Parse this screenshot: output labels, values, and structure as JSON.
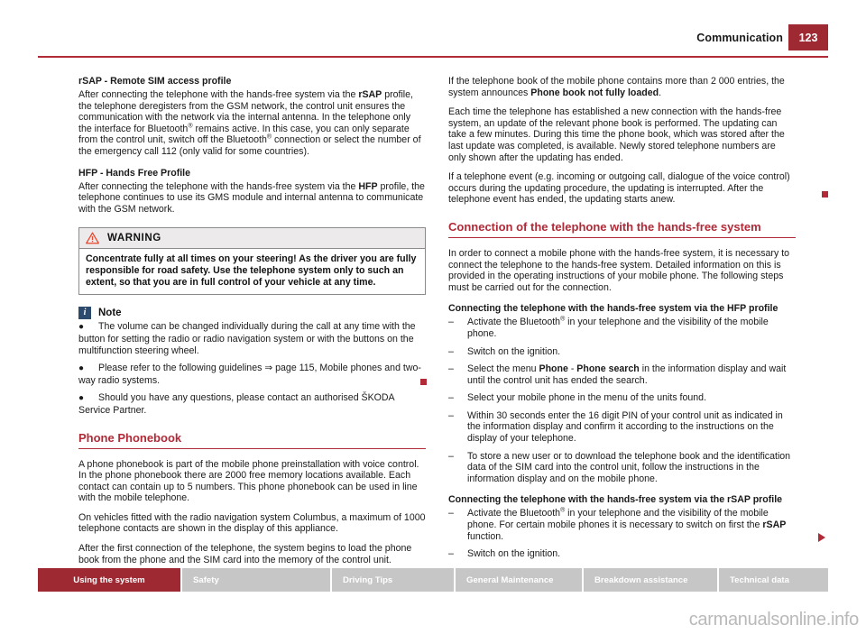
{
  "header": {
    "title": "Communication",
    "page_number": "123"
  },
  "left_column": {
    "rsap_heading": "rSAP - Remote SIM access profile",
    "rsap_paragraph": {
      "part1": "After connecting the telephone with the hands-free system via the ",
      "bold1": "rSAP",
      "part2": " profile, the telephone deregisters from the GSM network, the control unit ensures the communication with the network via the internal antenna. In the telephone only the interface for Bluetooth",
      "sup1": "®",
      "part3": " remains active. In this case, you can only separate from the control unit, switch off the Bluetooth",
      "sup2": "®",
      "part4": " connection or select the number of the emergency call 112 (only valid for some countries)."
    },
    "hfp_heading": "HFP - Hands Free Profile",
    "hfp_paragraph": {
      "part1": "After connecting the telephone with the hands-free system via the ",
      "bold1": "HFP",
      "part2": " profile, the telephone continues to use its GMS module and internal antenna to communicate with the GSM network."
    },
    "warning": {
      "label": "WARNING",
      "icon": "warning-triangle-icon",
      "body": "Concentrate fully at all times on your steering! As the driver you are fully responsible for road safety. Use the telephone system only to such an extent, so that you are in full control of your vehicle at any time."
    },
    "note": {
      "label": "Note",
      "icon": "info-icon",
      "bullets": [
        "The volume can be changed individually during the call at any time with the button for setting the radio or radio navigation system or with the buttons on the multifunction steering wheel.",
        "Please refer to the following guidelines ⇒ page 115, Mobile phones and two-way radio systems.",
        "Should you have any questions, please contact an authorised ŠKODA Service Partner."
      ]
    },
    "phonebook_heading": "Phone Phonebook",
    "phonebook_paragraphs": [
      "A phone phonebook is part of the mobile phone preinstallation with voice control. In the phone phonebook there are 2000 free memory locations available. Each contact can contain up to 5 numbers. This phone phonebook can be used in line with the mobile telephone.",
      "On vehicles fitted with the radio navigation system Columbus, a maximum of 1000 telephone contacts are shown in the display of this appliance.",
      "After the first connection of the telephone, the system begins to load the phone book from the phone and the SIM card into the memory of the control unit."
    ]
  },
  "right_column": {
    "para1": {
      "part1": "If the telephone book of the mobile phone contains more than 2 000 entries, the system announces ",
      "bold1": "Phone book not fully loaded",
      "part2": "."
    },
    "para2": "Each time the telephone has established a new connection with the hands-free system, an update of the relevant phone book is performed. The updating can take a few minutes. During this time the phone book, which was stored after the last update was completed, is available. Newly stored telephone numbers are only shown after the updating has ended.",
    "para3": "If a telephone event (e.g. incoming or outgoing call, dialogue of the voice control) occurs during the updating procedure, the updating is interrupted. After the telephone event has ended, the updating starts anew.",
    "connection_heading": "Connection of the telephone with the hands-free system",
    "connection_intro": "In order to connect a mobile phone with the hands-free system, it is necessary to connect the telephone to the hands-free system. Detailed information on this is provided in the operating instructions of your mobile phone. The following steps must be carried out for the connection.",
    "hfp_subheading": "Connecting the telephone with the hands-free system via the HFP profile",
    "hfp_steps": [
      {
        "part1": "Activate the Bluetooth",
        "sup1": "®",
        "part2": " in your telephone and the visibility of the mobile phone."
      },
      {
        "part1": "Switch on the ignition."
      },
      {
        "part1": "Select the menu ",
        "bold1": "Phone",
        "part2": " - ",
        "bold2": "Phone search",
        "part3": " in the information display and wait until the control unit has ended the search."
      },
      {
        "part1": "Select your mobile phone in the menu of the units found."
      },
      {
        "part1": "Within 30 seconds enter the 16 digit PIN of your control unit as indicated in the information display and confirm it according to the instructions on the display of your telephone."
      },
      {
        "part1": "To store a new user or to download the telephone book and the identification data of the SIM card into the control unit, follow the instructions in the information display and on the mobile phone."
      }
    ],
    "rsap_subheading": "Connecting the telephone with the hands-free system via the rSAP profile",
    "rsap_steps": [
      {
        "part1": "Activate the Bluetooth",
        "sup1": "®",
        "part2": " in your telephone and the visibility of the mobile phone. For certain mobile phones it is necessary to switch on first the ",
        "bold1": "rSAP",
        "part3": " function."
      },
      {
        "part1": "Switch on the ignition."
      }
    ]
  },
  "footer": {
    "tabs": [
      {
        "label": "Using the system",
        "active": true
      },
      {
        "label": "Safety",
        "active": false
      },
      {
        "label": "Driving Tips",
        "active": false
      },
      {
        "label": "General Maintenance",
        "active": false
      },
      {
        "label": "Breakdown assistance",
        "active": false
      },
      {
        "label": "Technical data",
        "active": false
      }
    ]
  },
  "watermark": "carmanualsonline.info",
  "colors": {
    "brand_red": "#b02a37",
    "tab_red": "#9e2933",
    "tab_gray": "#c6c6c6",
    "note_blue": "#2c4a6e",
    "warning_orange": "#e8452c"
  }
}
